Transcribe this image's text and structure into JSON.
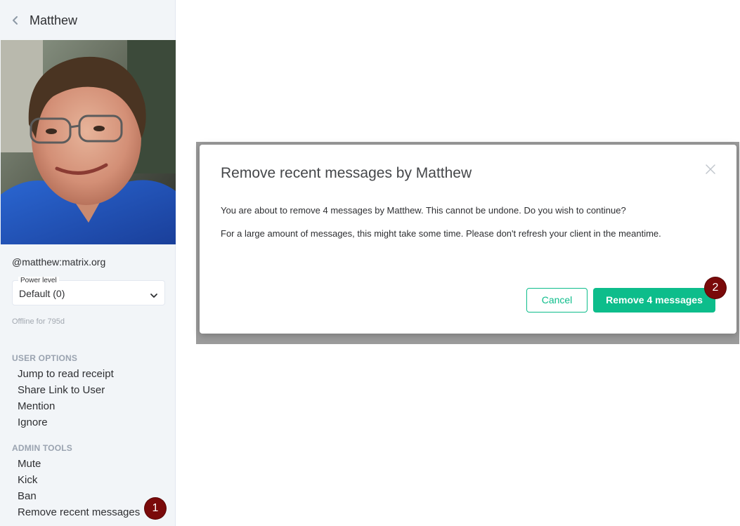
{
  "sidebar": {
    "user_name": "Matthew",
    "user_id": "@matthew:matrix.org",
    "power_level": {
      "legend": "Power level",
      "value": "Default (0)"
    },
    "presence": "Offline for 795d",
    "user_options": {
      "title": "USER OPTIONS",
      "items": [
        "Jump to read receipt",
        "Share Link to User",
        "Mention",
        "Ignore"
      ]
    },
    "admin_tools": {
      "title": "ADMIN TOOLS",
      "items": [
        "Mute",
        "Kick",
        "Ban",
        "Remove recent messages"
      ]
    }
  },
  "dialog": {
    "title": "Remove recent messages by Matthew",
    "message": "You are about to remove 4 messages by Matthew. This cannot be undone. Do you wish to continue?",
    "note": "For a large amount of messages, this might take some time. Please don't refresh your client in the meantime.",
    "cancel_label": "Cancel",
    "confirm_label": "Remove 4 messages"
  },
  "annotations": {
    "step1": "1",
    "step2": "2"
  },
  "colors": {
    "accent": "#0dbd8b",
    "badge": "#7a0a0a",
    "sidebar_bg": "#f2f5f8"
  },
  "icons": {
    "back": "chevron-left-icon",
    "dropdown": "chevron-down-icon",
    "close": "close-icon"
  }
}
